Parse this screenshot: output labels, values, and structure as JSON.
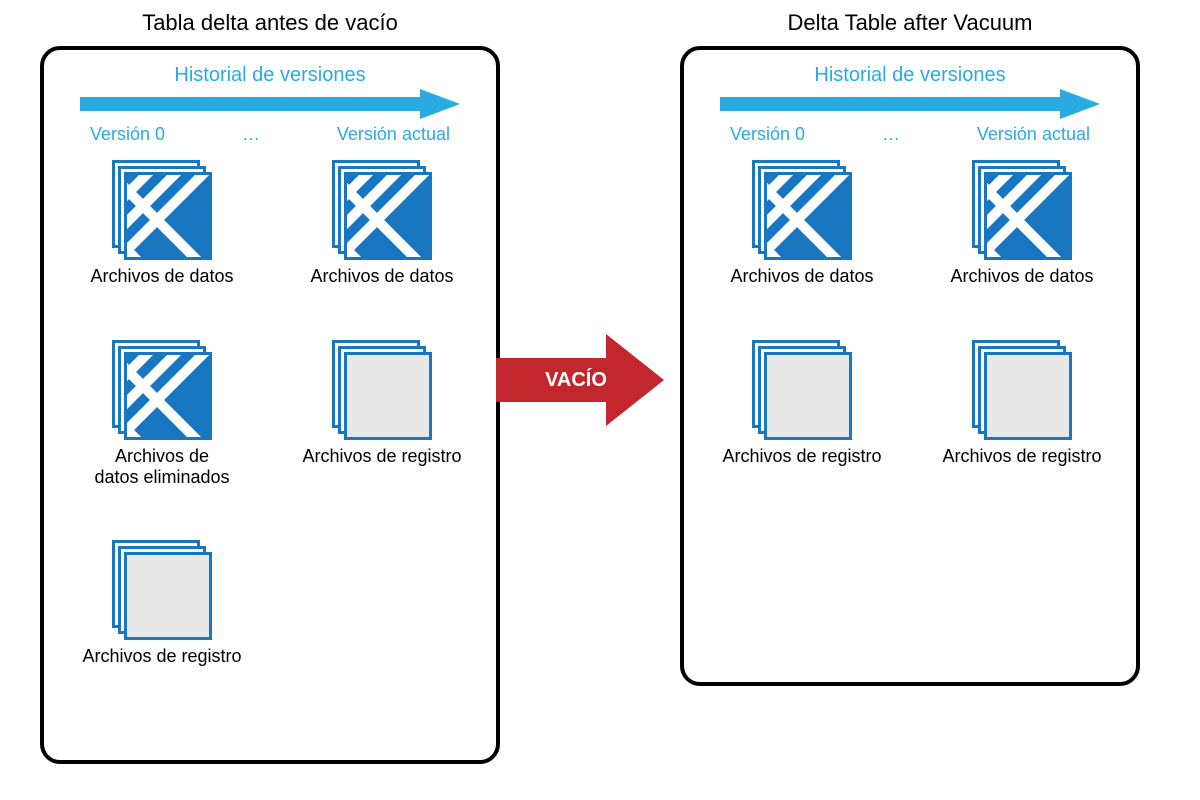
{
  "colors": {
    "accent": "#29abe2",
    "iconBlue": "#1976c1",
    "arrowRed": "#c1272d"
  },
  "before": {
    "title": "Tabla delta antes de vacío",
    "history_label": "Historial de versiones",
    "version_start": "Versión 0",
    "version_mid": "…",
    "version_end": "Versión actual",
    "items": {
      "data_v0": "Archivos de datos",
      "data_vcur": "Archivos de datos",
      "removed_data": "Archivos de\ndatos eliminados",
      "log_vcur": "Archivos de registro",
      "log_v0": "Archivos de registro"
    }
  },
  "vacuum_label": "VACÍO",
  "after": {
    "title": "Delta Table after Vacuum",
    "history_label": "Historial de versiones",
    "version_start": "Versión 0",
    "version_mid": "…",
    "version_end": "Versión actual",
    "items": {
      "data_v0": "Archivos de datos",
      "data_vcur": "Archivos de datos",
      "log_v0": "Archivos de registro",
      "log_vcur": "Archivos de registro"
    }
  }
}
